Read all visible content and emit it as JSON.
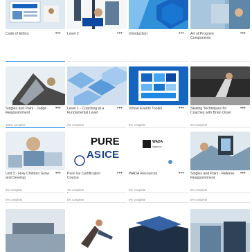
{
  "cards": [
    {
      "id": "c1",
      "title": "Code of Ethics",
      "progress_label": "",
      "progress": 0,
      "accent": "#1565c0"
    },
    {
      "id": "c2",
      "title": "Level 2",
      "progress_label": "",
      "progress": 0,
      "accent": "#0d47a1"
    },
    {
      "id": "c3",
      "title": "Introduction",
      "progress_label": "",
      "progress": 0,
      "accent": "#2196f3"
    },
    {
      "id": "c4",
      "title": "Art of Program Components",
      "progress_label": "",
      "progress": 0,
      "accent": "#1976d2"
    },
    {
      "id": "c5",
      "title": "Singles and Pairs - Judge Reappointment",
      "progress_label": "100% complete",
      "progress": 1.0,
      "accent": "#1e88e5"
    },
    {
      "id": "c6",
      "title": "Level 1 - Coaching at a Fundamental Level",
      "progress_label": "0% complete",
      "progress": 0,
      "accent": "#1e88e5"
    },
    {
      "id": "c7",
      "title": "Virtual Events Toolkit",
      "progress_label": "0% complete",
      "progress": 0,
      "accent": "#1e88e5"
    },
    {
      "id": "c8",
      "title": "Skating Techniques for Coaches with Brian Orser",
      "progress_label": "0% complete",
      "progress": 0,
      "accent": "#1e88e5"
    },
    {
      "id": "c9",
      "title": "Unit 3 - How Children Grow and Develop",
      "progress_label": "0% complete",
      "progress": 0,
      "accent": "#1e88e5"
    },
    {
      "id": "c10",
      "title": "Pure Ice Certification Course",
      "progress_label": "1% complete",
      "progress": 0.01,
      "accent": "#1e88e5"
    },
    {
      "id": "c11",
      "title": "WADA Resources",
      "progress_label": "0% complete",
      "progress": 0,
      "accent": "#1e88e5"
    },
    {
      "id": "c12",
      "title": "Singles and Pairs - Referee Reappointment",
      "progress_label": "0% complete",
      "progress": 0,
      "accent": "#1e88e5"
    },
    {
      "id": "c13",
      "title": "",
      "progress_label": "0% complete",
      "progress": 0,
      "accent": "#1e88e5"
    },
    {
      "id": "c14",
      "title": "",
      "progress_label": "0% complete",
      "progress": 0,
      "accent": "#1e88e5"
    },
    {
      "id": "c15",
      "title": "",
      "progress_label": "0% complete",
      "progress": 0,
      "accent": "#1e88e5"
    },
    {
      "id": "c16",
      "title": "",
      "progress_label": "0% complete",
      "progress": 0,
      "accent": "#1e88e5"
    }
  ],
  "logos": {
    "pure_ice_word1": "PURE",
    "pure_ice_word2": "ICE",
    "pure_ice_prefix": "AS",
    "wada_title": "WADA",
    "wada_sub": "Agency"
  },
  "menu_glyph": "•••"
}
